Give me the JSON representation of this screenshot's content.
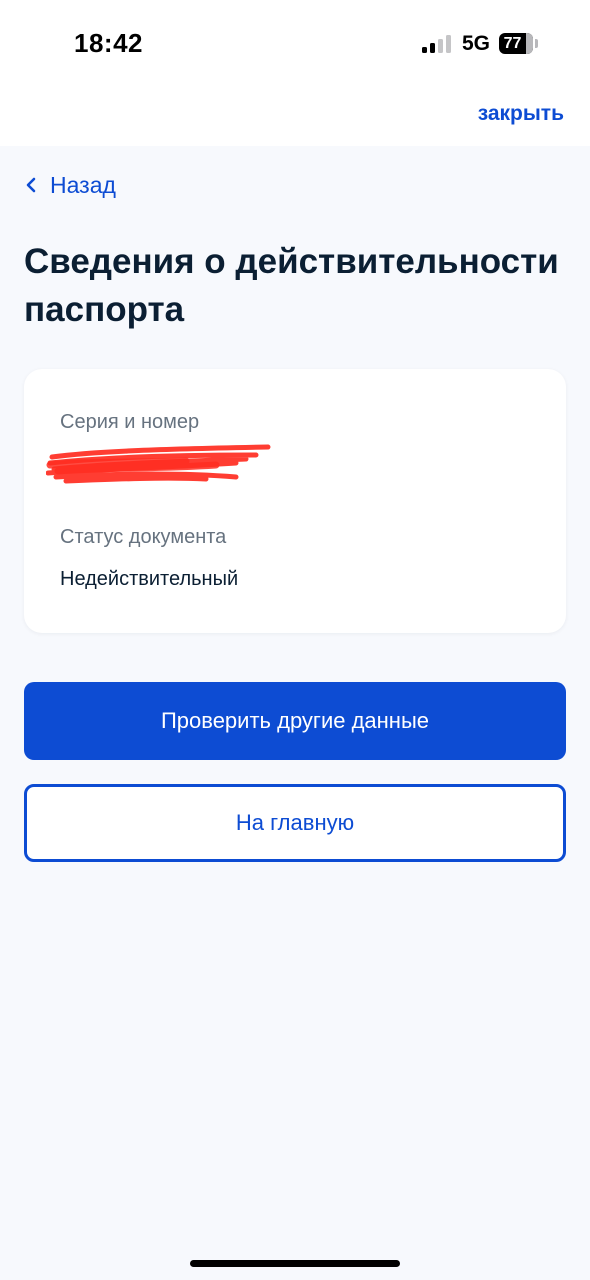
{
  "status_bar": {
    "time": "18:42",
    "network": "5G",
    "battery": "77",
    "signal_bars": 2
  },
  "header": {
    "close_label": "закрыть"
  },
  "nav": {
    "back_label": "Назад"
  },
  "page": {
    "title": "Сведения о действительности паспорта"
  },
  "card": {
    "series_label": "Серия и номер",
    "status_label": "Статус документа",
    "status_value": "Недействительный"
  },
  "actions": {
    "primary_label": "Проверить другие данные",
    "secondary_label": "На главную"
  },
  "colors": {
    "accent": "#0d4cd3",
    "background": "#f7f9fd",
    "text": "#0b1f33",
    "muted": "#66727f",
    "redaction": "#ff2d21"
  },
  "icons": {
    "back": "chevron-left-icon",
    "signal": "signal-icon",
    "battery": "battery-icon"
  }
}
